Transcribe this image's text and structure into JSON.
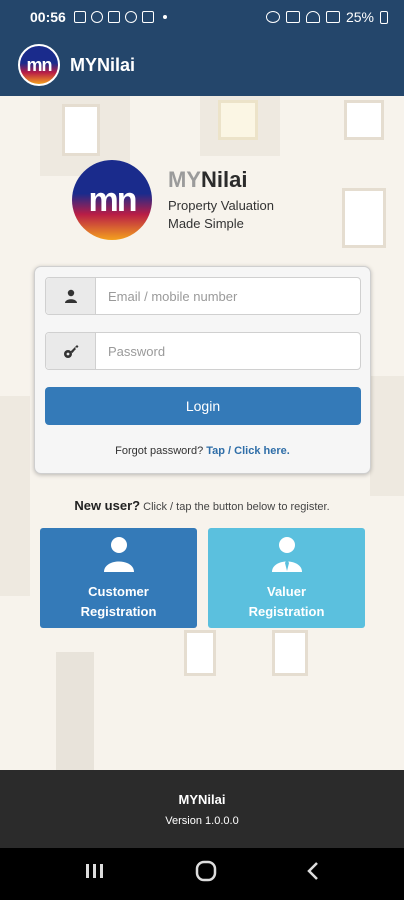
{
  "status_bar": {
    "time": "00:56",
    "battery": "25%"
  },
  "app_bar": {
    "logo_text": "mn",
    "title": "MYNilai"
  },
  "brand": {
    "logo_text": "mn",
    "name_prefix": "MY",
    "name_suffix": "Nilai",
    "tagline_line1": "Property Valuation",
    "tagline_line2": "Made Simple"
  },
  "login": {
    "email_placeholder": "Email / mobile number",
    "password_placeholder": "Password",
    "login_label": "Login",
    "forgot_text": "Forgot password?",
    "forgot_link": "Tap / Click here."
  },
  "register": {
    "new_user_label": "New user?",
    "new_user_hint": "Click / tap the button below to register.",
    "customer_line1": "Customer",
    "customer_line2": "Registration",
    "valuer_line1": "Valuer",
    "valuer_line2": "Registration"
  },
  "footer": {
    "title": "MYNilai",
    "version": "Version 1.0.0.0"
  },
  "colors": {
    "header": "#24466b",
    "primary": "#347ab8",
    "info": "#5bc0de",
    "footer": "#2b2b2b"
  }
}
